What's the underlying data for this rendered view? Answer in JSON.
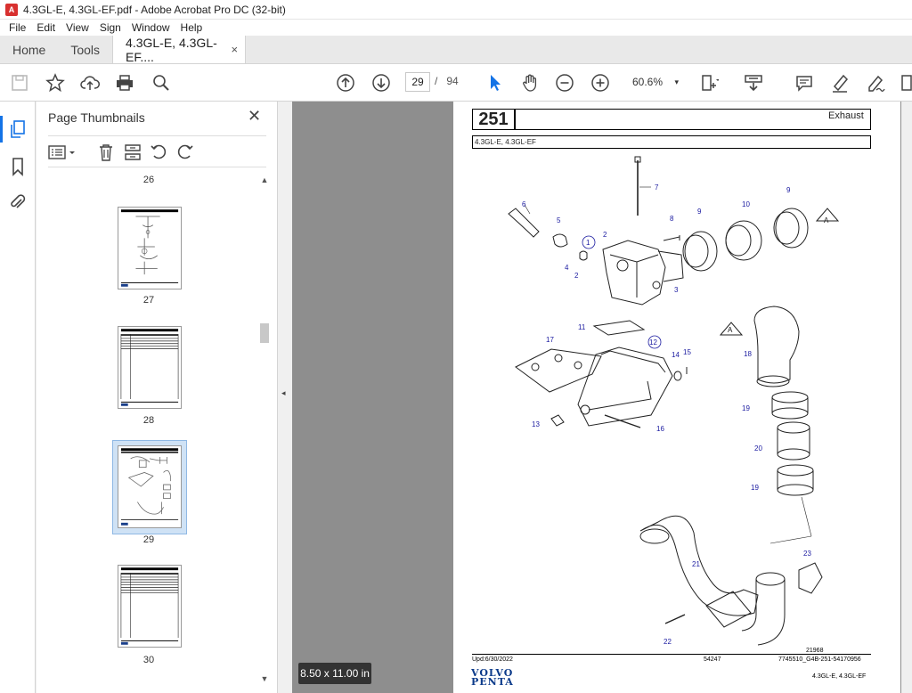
{
  "window": {
    "title": "4.3GL-E, 4.3GL-EF.pdf - Adobe Acrobat Pro DC (32-bit)",
    "app_icon": "A"
  },
  "menu": [
    "File",
    "Edit",
    "View",
    "Sign",
    "Window",
    "Help"
  ],
  "tabs": {
    "home": "Home",
    "tools": "Tools",
    "doc": "4.3GL-E, 4.3GL-EF....",
    "close": "×"
  },
  "toolbar": {
    "page_current": "29",
    "page_sep": "/",
    "page_total": "94",
    "zoom": "60.6%",
    "zoom_caret": "▾"
  },
  "thumbnails": {
    "title": "Page Thumbnails",
    "close": "✕",
    "pages": [
      "26",
      "27",
      "28",
      "29",
      "30"
    ],
    "selected": "29"
  },
  "collapse_arrow": "◂",
  "page_size_badge": "8.50 x 11.00 in",
  "document": {
    "section_number": "251",
    "section_title": "Exhaust",
    "model": "4.3GL-E, 4.3GL-EF",
    "drawing_number": "21968",
    "updated": "Upd:6/30/2022",
    "code": "54247",
    "part_ref": "7745510_G4B-251-54170956",
    "footer_model": "4.3GL-E, 4.3GL-EF",
    "brand_line1": "VOLVO",
    "brand_line2": "PENTA",
    "labels": [
      "1",
      "2",
      "2",
      "3",
      "4",
      "5",
      "6",
      "7",
      "8",
      "9",
      "9",
      "10",
      "11",
      "12",
      "13",
      "14",
      "15",
      "16",
      "17",
      "18",
      "19",
      "19",
      "20",
      "21",
      "22",
      "23",
      "A",
      "A"
    ]
  },
  "colors": {
    "accent": "#1473e6",
    "viewer_bg": "#8e8e8e",
    "label_blue": "#1a1aa0"
  }
}
